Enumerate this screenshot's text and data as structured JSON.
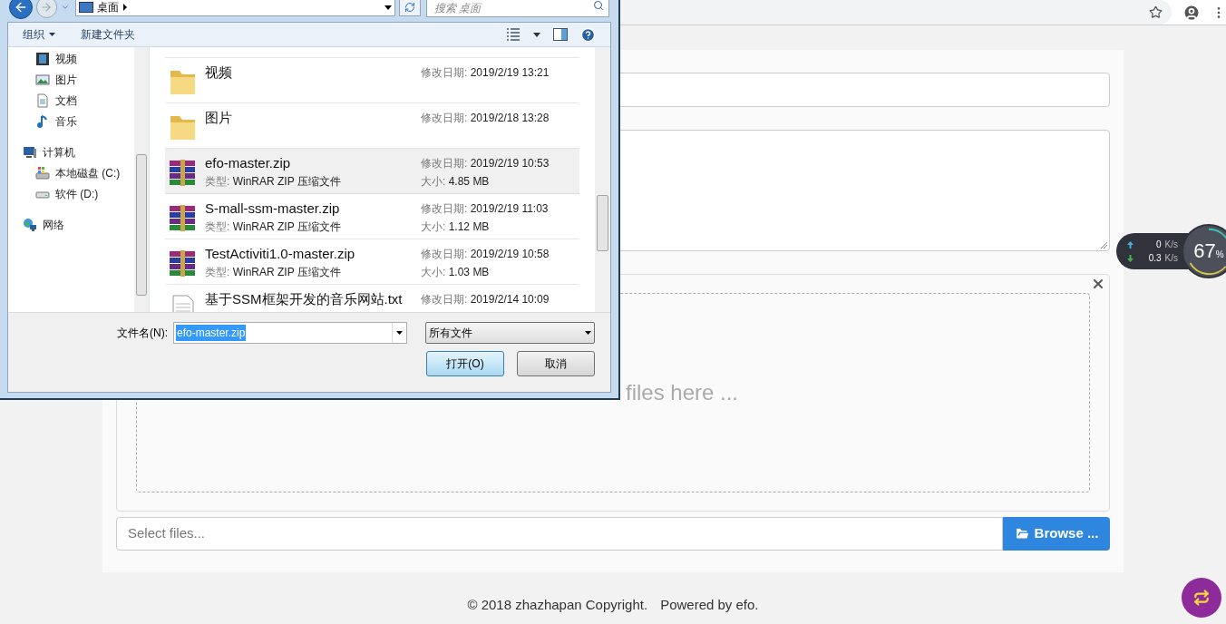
{
  "page": {
    "drop_zone": {
      "text": "files here ..."
    },
    "file_input": {
      "placeholder": "Select files...",
      "button": "Browse ..."
    },
    "footer": [
      "© 2018 zhazhapan Copyright.",
      "Powered by efo."
    ]
  },
  "speed_widget": {
    "up": "0",
    "up_unit": "K/s",
    "down": "0.3",
    "down_unit": "K/s",
    "percent": "67",
    "percent_sign": "%"
  },
  "dialog": {
    "address": "桌面",
    "search": {
      "placeholder": "搜索 桌面"
    },
    "commands": [
      "组织",
      "新建文件夹"
    ],
    "nav": [
      {
        "children": [
          {
            "label": "视频",
            "kind": "video"
          },
          {
            "label": "图片",
            "kind": "image"
          },
          {
            "label": "文档",
            "kind": "doc"
          },
          {
            "label": "音乐",
            "kind": "music"
          }
        ]
      },
      {
        "label": "计算机",
        "kind": "computer",
        "children": [
          {
            "label": "本地磁盘 (C:)",
            "kind": "system-drive"
          },
          {
            "label": "软件 (D:)",
            "kind": "drive"
          }
        ]
      },
      {
        "label": "网络",
        "kind": "network"
      }
    ],
    "files": [
      {
        "name": "视频",
        "kind": "folder",
        "modified_label": "修改日期:",
        "modified": "2019/2/19 13:21",
        "selected": false
      },
      {
        "name": "图片",
        "kind": "folder",
        "modified_label": "修改日期:",
        "modified": "2019/2/18 13:28",
        "selected": false
      },
      {
        "name": "efo-master.zip",
        "kind": "zip",
        "modified_label": "修改日期:",
        "modified": "2019/2/19 10:53",
        "type_label": "类型:",
        "type": "WinRAR ZIP 压缩文件",
        "size_label": "大小:",
        "size": "4.85 MB",
        "selected": true
      },
      {
        "name": "S-mall-ssm-master.zip",
        "kind": "zip",
        "modified_label": "修改日期:",
        "modified": "2019/2/19 11:03",
        "type_label": "类型:",
        "type": "WinRAR ZIP 压缩文件",
        "size_label": "大小:",
        "size": "1.12 MB",
        "selected": false
      },
      {
        "name": "TestActiviti1.0-master.zip",
        "kind": "zip",
        "modified_label": "修改日期:",
        "modified": "2019/2/19 10:58",
        "type_label": "类型:",
        "type": "WinRAR ZIP 压缩文件",
        "size_label": "大小:",
        "size": "1.03 MB",
        "selected": false
      },
      {
        "name": "基于SSM框架开发的音乐网站.txt",
        "kind": "text",
        "modified_label": "修改日期:",
        "modified": "2019/2/14 10:09",
        "selected": false
      }
    ],
    "filename": {
      "label": "文件名(N):",
      "value": "efo-master.zip"
    },
    "filetype": "所有文件",
    "buttons": [
      {
        "label": "打开(O)",
        "kind": "default"
      },
      {
        "label": "取消",
        "kind": "normal"
      }
    ]
  }
}
